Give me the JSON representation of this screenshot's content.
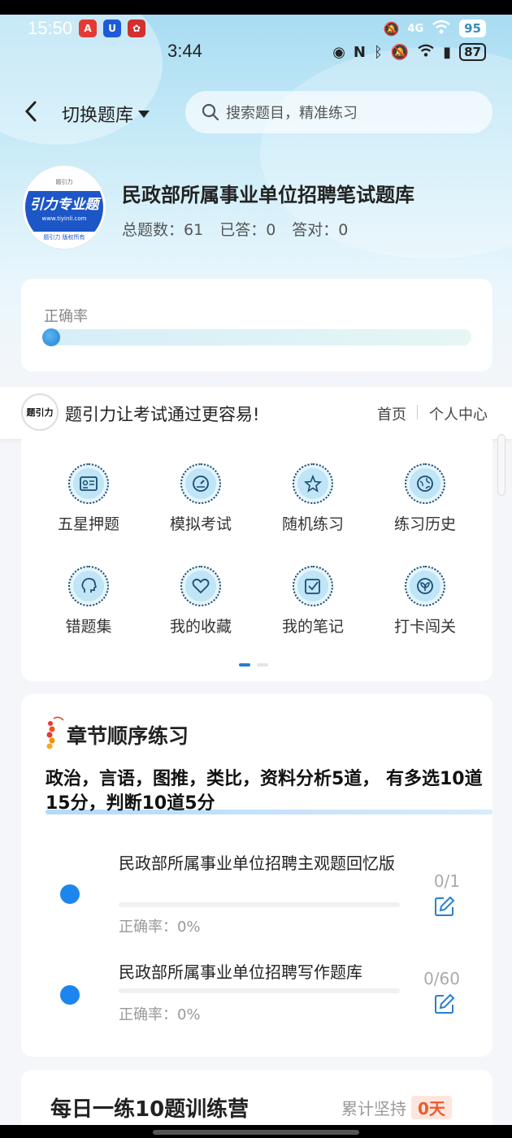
{
  "status_outer": {
    "time": "15:50",
    "network": "4G",
    "battery": "95"
  },
  "status_inner": {
    "time": "3:44",
    "battery": "87"
  },
  "nav": {
    "back_icon": "chevron-left-icon",
    "switch_label": "切换题库",
    "search_placeholder": "搜索题目，精准练习"
  },
  "bank": {
    "logo_top": "题引力",
    "logo_main": "引力专业题",
    "logo_url": "www.tiyinli.com",
    "logo_bottom": "题引力 版权所有",
    "title": "民政部所属事业单位招聘笔试题库",
    "total_label": "总题数：61",
    "answered_label": "已答：0",
    "correct_label": "答对：0"
  },
  "accuracy": {
    "label": "正确率",
    "value": 0
  },
  "promo": {
    "logo_text": "题引力",
    "text": "题引力让考试通过更容易!",
    "home": "首页",
    "me": "个人中心"
  },
  "features": [
    {
      "label": "五星押题",
      "icon": "id-card-icon"
    },
    {
      "label": "模拟考试",
      "icon": "gauge-icon"
    },
    {
      "label": "随机练习",
      "icon": "shuffle-star-icon"
    },
    {
      "label": "练习历史",
      "icon": "globe-icon"
    },
    {
      "label": "错题集",
      "icon": "head-icon"
    },
    {
      "label": "我的收藏",
      "icon": "heart-icon"
    },
    {
      "label": "我的笔记",
      "icon": "checkbox-icon"
    },
    {
      "label": "打卡闯关",
      "icon": "leaf-icon"
    }
  ],
  "chapter": {
    "title": "章节顺序练习",
    "desc": "政治，言语，图推，类比，资料分析5道， 有多选10道15分，判断10道5分",
    "items": [
      {
        "title": "民政部所属事业单位招聘主观题回忆版",
        "count": "0/1",
        "accuracy": "正确率：0%"
      },
      {
        "title": "民政部所属事业单位招聘写作题库",
        "count": "0/60",
        "accuracy": "正确率：0%"
      }
    ]
  },
  "daily": {
    "title": "每日一练10题训练营",
    "persist_label": "累计坚持",
    "days": "0天"
  },
  "colors": {
    "accent": "#1d86ee",
    "header_bg": "#a9dcf2",
    "days_red": "#f0592a"
  }
}
